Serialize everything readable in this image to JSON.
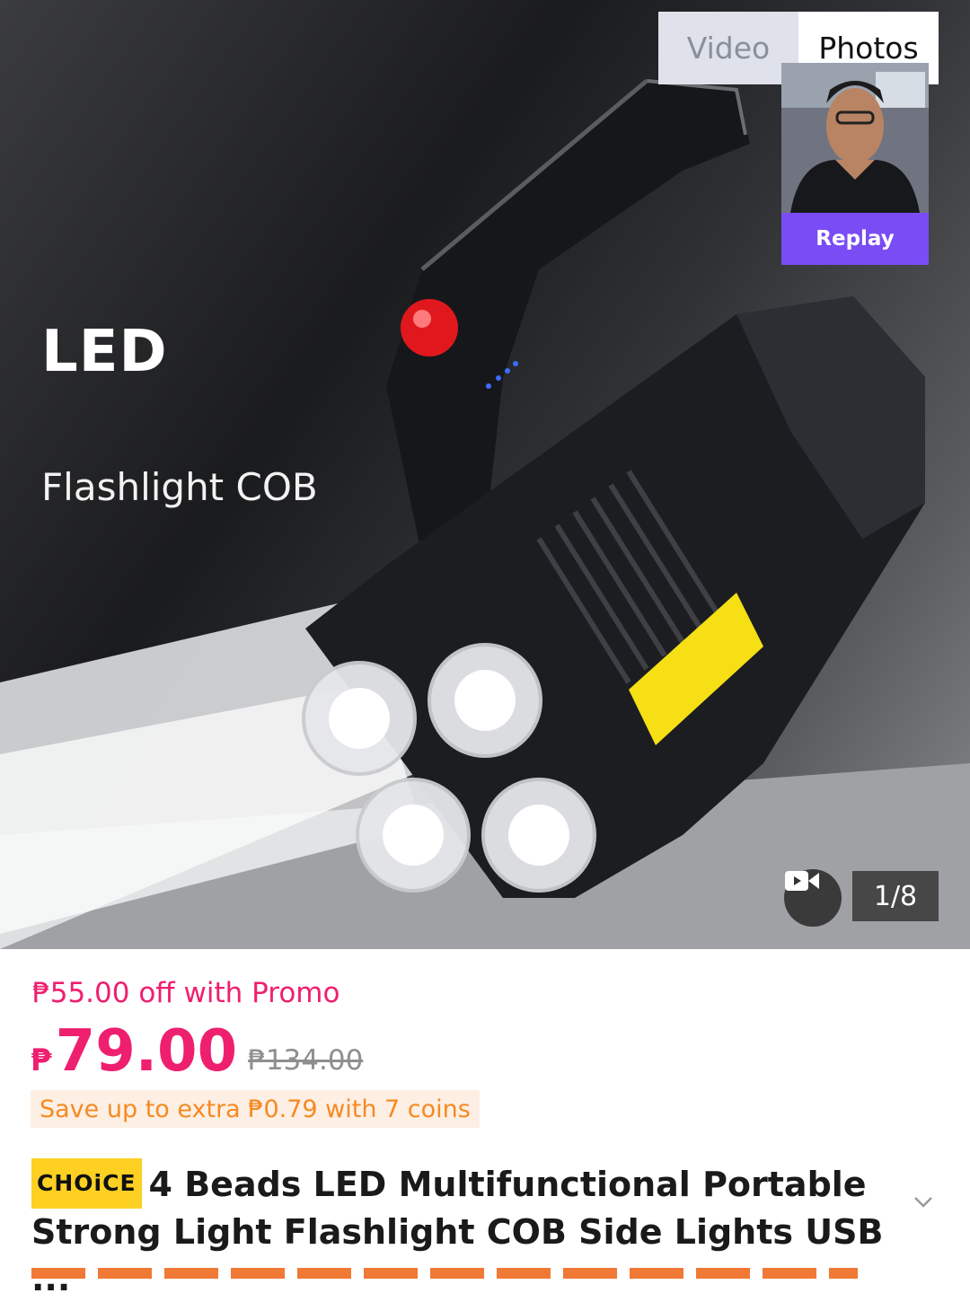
{
  "hero": {
    "headline": "LED",
    "subheadline": "Flashlight COB",
    "media_tabs": [
      {
        "label": "Video",
        "active": false
      },
      {
        "label": "Photos",
        "active": true
      }
    ],
    "replay_label": "Replay",
    "image_counter": "1/8"
  },
  "product": {
    "promo_text": "₱55.00 off with Promo",
    "currency_symbol": "₱",
    "price": "79.00",
    "original_price": "₱134.00",
    "coins_text": "Save up to extra ₱0.79 with 7 coins",
    "badge": "CHOiCE",
    "title": "4 Beads LED Multifunctional Portable Strong Light Flashlight COB Side Lights USB ..."
  },
  "colors": {
    "accent_pink": "#ef1f6f",
    "coin_orange": "#f58a22",
    "replay_purple": "#7a4cf5",
    "choice_yellow": "#fdd022"
  },
  "icons": [
    "video-camera-icon",
    "chevron-down-icon"
  ]
}
